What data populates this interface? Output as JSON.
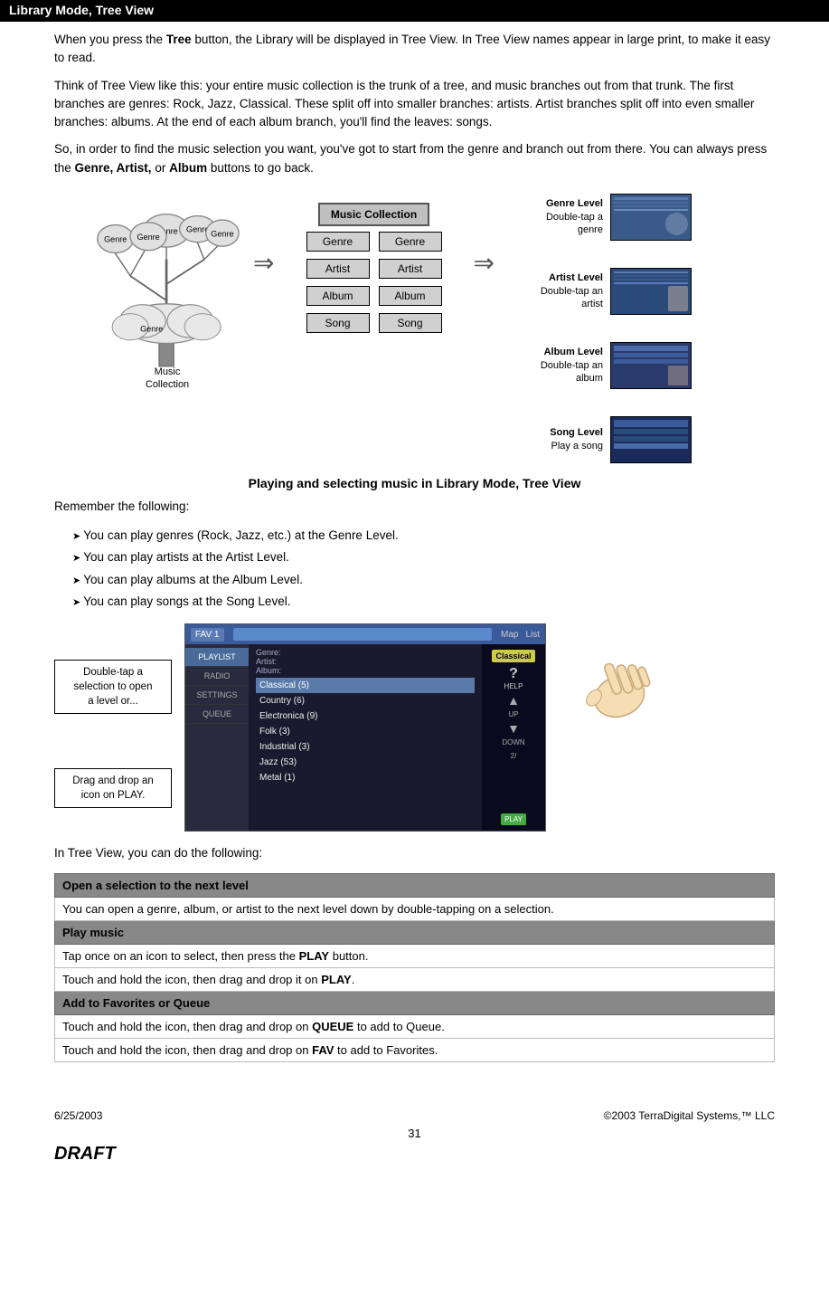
{
  "header": {
    "title": "Library Mode, Tree View"
  },
  "content": {
    "para1": "When you press the Tree button, the Library will be displayed in Tree View.  In Tree View names appear in large print, to make it easy to read.",
    "para1_bold": "Tree",
    "para2": "Think of Tree View like this: your entire music collection is the trunk of a tree, and music branches out from that trunk.  The first branches are genres: Rock, Jazz, Classical.  These split off into smaller branches: artists.  Artist branches split off into even smaller branches: albums.  At the end of each album branch, you'll find the leaves: songs.",
    "para3_start": "So, in order to find the music selection you want, you've got to start from the genre and branch out from there.  You can always press the ",
    "para3_bold": "Genre, Artist,",
    "para3_or_bold": "Album",
    "para3_end": " buttons to go back.",
    "diagram": {
      "tree_labels": [
        "Genre",
        "Genre",
        "Genre",
        "Genre",
        "Genre",
        "Genre"
      ],
      "music_collection_box": "Music Collection",
      "middle_boxes": {
        "row1": [
          "Genre",
          "Genre"
        ],
        "row2": [
          "Artist",
          "Artist"
        ],
        "row3": [
          "Album",
          "Album"
        ],
        "row4": [
          "Song",
          "Song"
        ]
      },
      "bottom_label": "Music\nCollection",
      "annotations": {
        "genre_level": "Genre Level\nDouble-tap a\ngenre",
        "artist_level": "Artist Level\nDouble-tap an\nartist",
        "album_level": "Album Level\nDouble-tap an\nalbum",
        "song_level": "Song Level\nPlay a song"
      }
    },
    "playing_section": {
      "title": "Playing and selecting music in Library Mode, Tree View",
      "remember": "Remember the following:",
      "bullets": [
        "You can play genres (Rock, Jazz, etc.) at the Genre Level.",
        "You can play artists at the Artist Level.",
        "You can play albums at the Album Level.",
        "You can play songs at the Song Level."
      ],
      "screenshot": {
        "top_bar": {
          "fav1": "FAV 1",
          "map": "Map",
          "list": "List"
        },
        "breadcrumb": {
          "genre": "Genre:",
          "artist": "Artist:",
          "album": "Album:"
        },
        "genres": [
          "Classical (5)",
          "Country (6)",
          "Electronica (9)",
          "Folk (3)",
          "Industrial (3)",
          "Jazz (53)",
          "Metal (1)"
        ],
        "nav_items": [
          "PLAYLIST",
          "RADIO",
          "SETTINGS",
          "QUEUE"
        ],
        "right_panel": {
          "help": "?",
          "help_label": "HELP",
          "up": "▲",
          "up_label": "UP",
          "down": "▼",
          "down_label": "DOWN",
          "play": "PLAY"
        }
      },
      "callout1": "Double-tap a\nselection to open\na level or...",
      "callout2": "Drag and drop an\nicon on PLAY."
    },
    "in_tree_view": "In Tree View, you can do the following:",
    "table": {
      "rows": [
        {
          "type": "header",
          "text": "Open a selection to the next level"
        },
        {
          "type": "data",
          "text": "You can open a genre, album, or artist to the next level down by double-tapping on a selection."
        },
        {
          "type": "header",
          "text": "Play music"
        },
        {
          "type": "data",
          "text": "Tap once on an icon to select, then press the PLAY button."
        },
        {
          "type": "data",
          "text": "Touch and hold the icon, then drag and drop it on PLAY."
        },
        {
          "type": "header",
          "text": "Add to Favorites or Queue"
        },
        {
          "type": "data",
          "text": "Touch and hold the icon, then drag and drop on QUEUE to add to Queue."
        },
        {
          "type": "data",
          "text": "Touch and hold the icon, then drag and drop on FAV to add to Favorites."
        }
      ],
      "bold_words": {
        "row3": "PLAY",
        "row4": "PLAY",
        "row6": "QUEUE",
        "row7": "FAV"
      }
    }
  },
  "footer": {
    "date": "6/25/2003",
    "copyright": "©2003 TerraDigital Systems,™ LLC",
    "page_number": "31",
    "draft": "DRAFT"
  }
}
